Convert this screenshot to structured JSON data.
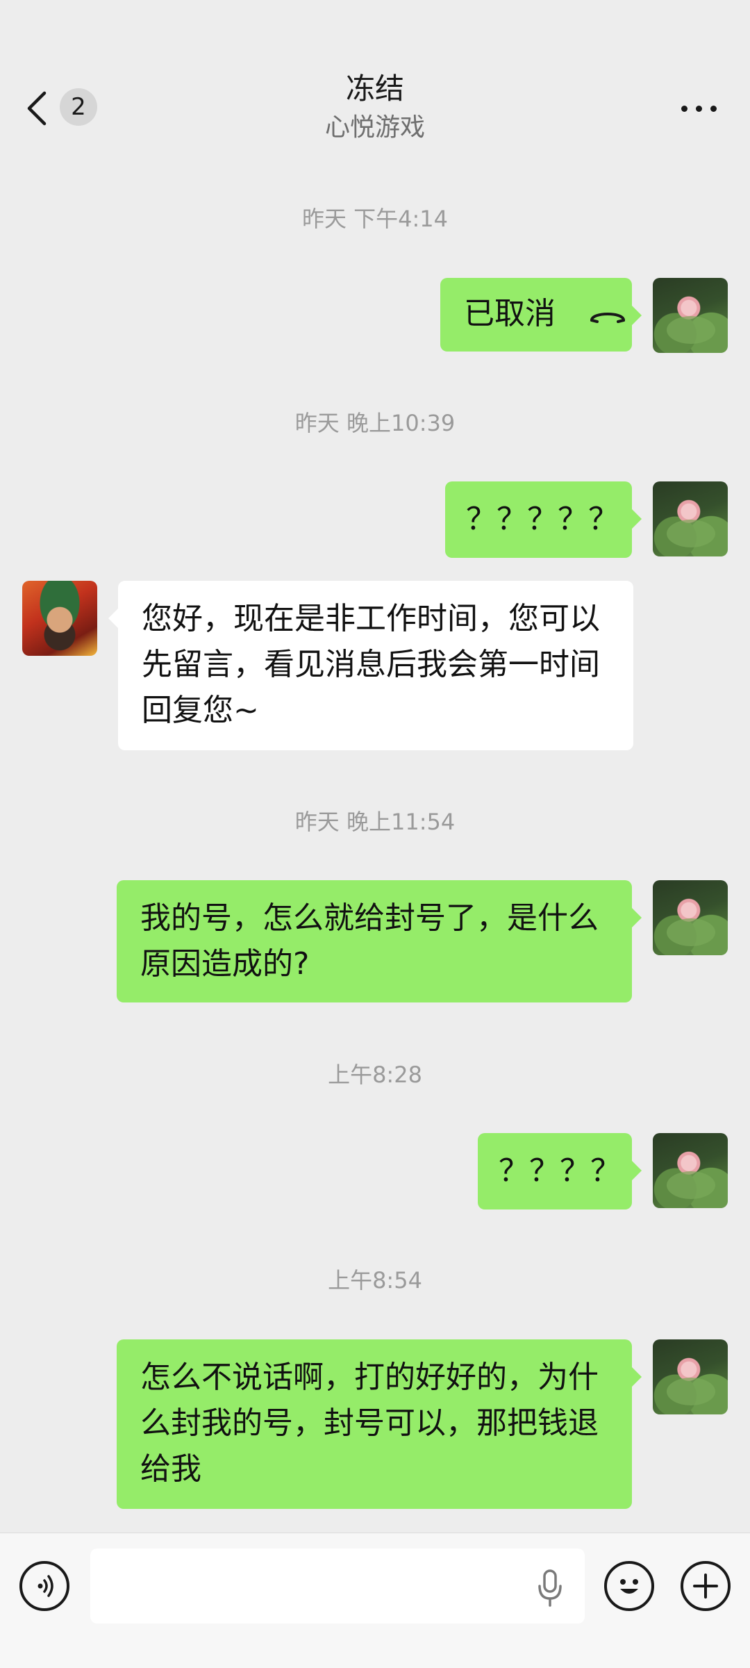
{
  "header": {
    "unread_count": "2",
    "title": "冻结",
    "subtitle": "心悦游戏"
  },
  "messages": [
    {
      "type": "time",
      "text": "昨天 下午4:14"
    },
    {
      "type": "call",
      "direction": "out",
      "text": "已取消",
      "icon": "hang-up-phone-icon"
    },
    {
      "type": "time",
      "text": "昨天 晚上10:39"
    },
    {
      "type": "text",
      "direction": "out",
      "text": "？？？？？"
    },
    {
      "type": "text",
      "direction": "in",
      "lines": [
        "您好，现在是非工作时间，您可以",
        "先留言，看见消息后我会第一时间",
        "回复您~"
      ]
    },
    {
      "type": "time",
      "text": "昨天 晚上11:54"
    },
    {
      "type": "text",
      "direction": "out",
      "lines": [
        "我的号，怎么就给封号了，是什么",
        "原因造成的?"
      ]
    },
    {
      "type": "time",
      "text": "上午8:28"
    },
    {
      "type": "text",
      "direction": "out",
      "text": "？？？？"
    },
    {
      "type": "time",
      "text": "上午8:54"
    },
    {
      "type": "text",
      "direction": "out",
      "lines": [
        "怎么不说话啊，打的好好的，为什",
        "么封我的号，封号可以，那把钱退",
        "给我"
      ]
    }
  ],
  "input_bar": {
    "value": "",
    "placeholder": "",
    "icons": [
      "voice-mode-icon",
      "microphone-icon",
      "emoji-icon",
      "plus-icon"
    ]
  },
  "colors": {
    "background": "#ededed",
    "outgoing_bubble": "#95ec69",
    "incoming_bubble": "#ffffff",
    "time_text": "#9a9a9a"
  }
}
